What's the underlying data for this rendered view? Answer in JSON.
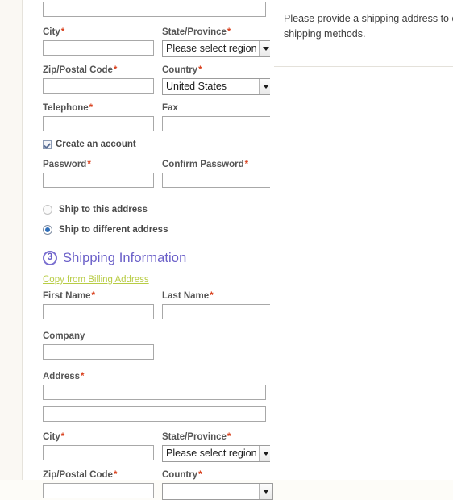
{
  "info_panel": {
    "message_line1": "Please provide a shipping address to c",
    "message_line2": "shipping methods."
  },
  "billing": {
    "address_line2_value": "",
    "fields": {
      "city_label": "City",
      "state_label": "State/Province",
      "state_value": "Please select region",
      "zip_label": "Zip/Postal Code",
      "country_label": "Country",
      "country_value": "United States",
      "telephone_label": "Telephone",
      "fax_label": "Fax",
      "password_label": "Password",
      "confirm_password_label": "Confirm Password"
    },
    "create_account_label": "Create an account",
    "ship_same_label": "Ship to this address",
    "ship_different_label": "Ship to different address",
    "values": {
      "city": "",
      "zip": "",
      "telephone": "",
      "fax": "",
      "password": "",
      "confirm_password": ""
    }
  },
  "shipping": {
    "step_number": "3",
    "title": "Shipping Information",
    "copy_link_label": "Copy from Billing Address",
    "fields": {
      "first_name_label": "First Name",
      "last_name_label": "Last Name",
      "company_label": "Company",
      "address_label": "Address",
      "city_label": "City",
      "state_label": "State/Province",
      "state_value": "Please select region",
      "zip_label": "Zip/Postal Code",
      "country_label": "Country"
    },
    "values": {
      "first_name": "",
      "last_name": "",
      "company": "",
      "address1": "",
      "address2": "",
      "city": "",
      "zip": ""
    }
  },
  "required_marker": "*",
  "colors": {
    "accent_purple": "#6a5fc8",
    "link_green": "#b8cc45",
    "required_red": "#d9411e",
    "radio_blue": "#2f6fba"
  }
}
